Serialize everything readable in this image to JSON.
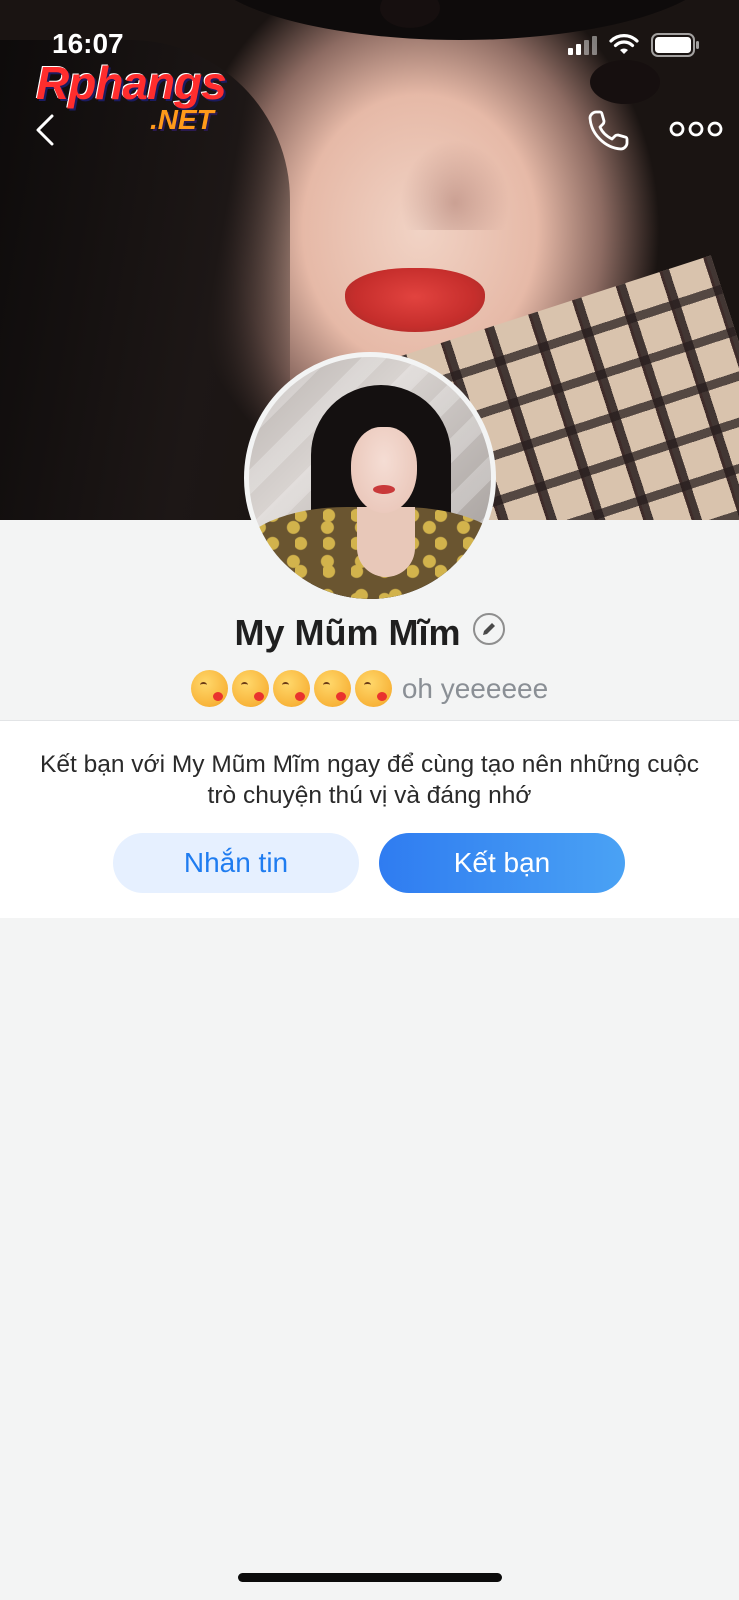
{
  "status_bar": {
    "time": "16:07",
    "icons": [
      "cellular-signal-icon",
      "wifi-icon",
      "battery-icon"
    ]
  },
  "watermark": {
    "main": "Rphangs",
    "sub": ".NET"
  },
  "header": {
    "back_icon": "chevron-left-icon",
    "call_icon": "phone-icon",
    "more_icon": "more-horizontal-icon"
  },
  "profile": {
    "name": "My Mũm Mĩm",
    "name_edit_icon": "pencil-icon",
    "status_emoji_count": 5,
    "status_emoji": "kissing-heart-emoji",
    "status_text": "oh yeeeeee"
  },
  "invite": {
    "message": "Kết bạn với My Mũm Mĩm ngay để cùng tạo nên những cuộc trò chuyện thú vị và đáng nhớ",
    "message_button": "Nhắn tin",
    "add_friend_button": "Kết bạn"
  },
  "colors": {
    "accent": "#2f7cf1",
    "accent_light": "#e6f0ff",
    "background": "#f3f4f4",
    "panel": "#ffffff"
  }
}
